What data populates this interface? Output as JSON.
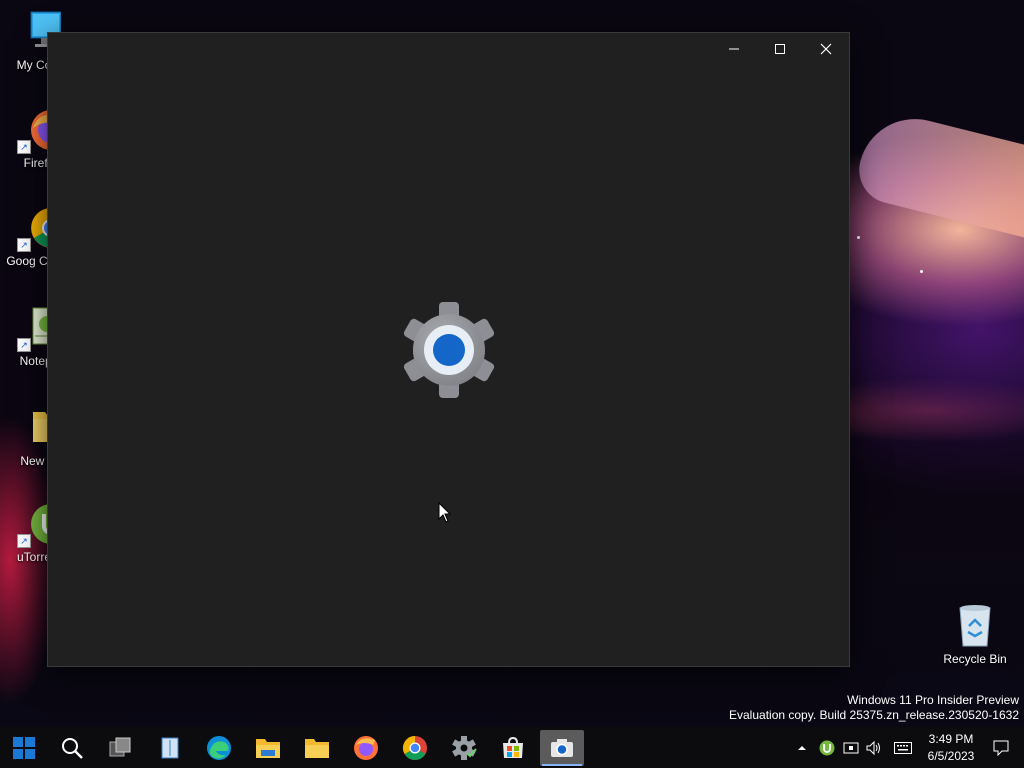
{
  "desktop": {
    "icons": [
      {
        "label": "My Com",
        "icon": "computer-icon"
      },
      {
        "label": "Firefo",
        "icon": "firefox-icon"
      },
      {
        "label": "Goog Chron",
        "icon": "chrome-icon"
      },
      {
        "label": "Notepa",
        "icon": "notepad-icon"
      },
      {
        "label": "New fo",
        "icon": "folder-icon"
      },
      {
        "label": "uTorrent",
        "icon": "utorrent-icon"
      }
    ],
    "recycle_bin": {
      "label": "Recycle Bin",
      "icon": "recycle-bin-icon"
    }
  },
  "window": {
    "app": "Settings",
    "splash_icon": "gear-icon",
    "controls": {
      "minimize": "minimize-icon",
      "maximize": "maximize-icon",
      "close": "close-icon"
    }
  },
  "watermark": {
    "line1": "Windows 11 Pro Insider Preview",
    "line2": "Evaluation copy. Build 25375.zn_release.230520-1632"
  },
  "taskbar": {
    "items": [
      {
        "icon": "start-icon"
      },
      {
        "icon": "search-icon"
      },
      {
        "icon": "task-view-icon"
      },
      {
        "icon": "reader-icon"
      },
      {
        "icon": "edge-icon"
      },
      {
        "icon": "file-explorer-icon"
      },
      {
        "icon": "folder-icon"
      },
      {
        "icon": "firefox-icon"
      },
      {
        "icon": "chrome-icon"
      },
      {
        "icon": "settings-icon"
      },
      {
        "icon": "store-icon"
      },
      {
        "icon": "camera-icon",
        "active": true
      }
    ],
    "tray": [
      "chevron-up-icon",
      "utorrent-icon",
      "network-icon",
      "volume-icon",
      "keyboard-icon"
    ],
    "clock": {
      "time": "3:49 PM",
      "date": "6/5/2023"
    },
    "notification_icon": "notification-icon"
  },
  "colors": {
    "window_bg": "#202020",
    "taskbar_bg": "#0c0c0e",
    "accent": "#1a5fd0"
  }
}
